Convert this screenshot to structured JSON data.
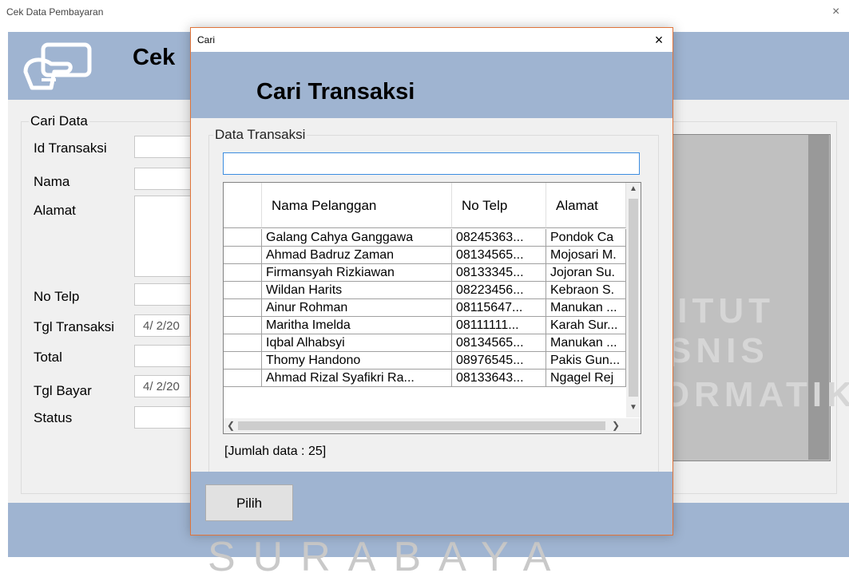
{
  "background_window": {
    "title": "Cek Data Pembayaran",
    "heading": "Cek",
    "group_label": "Cari Data",
    "labels": {
      "id_transaksi": "Id Transaksi",
      "nama": "Nama",
      "alamat": "Alamat",
      "no_telp": "No Telp",
      "tgl_transaksi": "Tgl Transaksi",
      "total": "Total",
      "tgl_bayar": "Tgl Bayar",
      "status": "Status"
    },
    "tgl_transaksi_value": "4/  2/20",
    "tgl_bayar_value": "4/  2/20",
    "watermark": "SURABAYA",
    "watermark_line1": "STITUT BISNIS",
    "watermark_line2": "DAN INFORMATIKA",
    "close_glyph": "×",
    "accent_color": "#9fb4d1"
  },
  "dialog": {
    "window_title": "Cari",
    "close_glyph": "×",
    "heading": "Cari Transaksi",
    "group_label": "Data Transaksi",
    "search_value": "",
    "columns": [
      "Nama Pelanggan",
      "No Telp",
      "Alamat"
    ],
    "rows": [
      [
        "Galang Cahya Ganggawa",
        "08245363...",
        "Pondok Ca"
      ],
      [
        "Ahmad Badruz Zaman",
        "08134565...",
        "Mojosari M."
      ],
      [
        "Firmansyah Rizkiawan",
        "08133345...",
        "Jojoran Su."
      ],
      [
        "Wildan Harits",
        "08223456...",
        "Kebraon S."
      ],
      [
        "Ainur Rohman",
        "08115647...",
        "Manukan ..."
      ],
      [
        "Maritha Imelda",
        "08111111...",
        "Karah Sur..."
      ],
      [
        "Iqbal Alhabsyi",
        "08134565...",
        "Manukan ..."
      ],
      [
        "Thomy Handono",
        "08976545...",
        "Pakis Gun..."
      ],
      [
        "Ahmad Rizal Syafikri Ra...",
        "08133643...",
        "Ngagel Rej"
      ]
    ],
    "count_label": "[Jumlah data : 25]",
    "pilih_label": "Pilih",
    "border_color": "#e0743a"
  }
}
